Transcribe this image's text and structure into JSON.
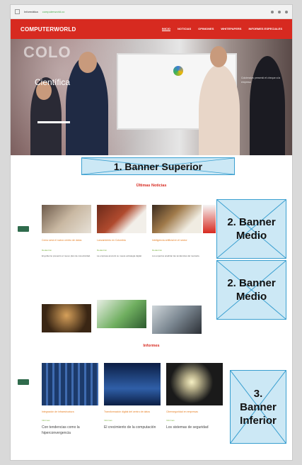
{
  "browser": {
    "title": "Informática",
    "url": "computerworld.co"
  },
  "header": {
    "logo": "COMPUTERWORLD",
    "nav": [
      "INICIO",
      "NOTICIAS",
      "OPINIONES",
      "WHITEPAPERS",
      "INFORMES ESPECIALES"
    ]
  },
  "hero": {
    "big_text": "COLO",
    "label": "Científica",
    "side_text": "Colciencias presentó el cheque a la empresa"
  },
  "banners": {
    "top": "1. Banner Superior",
    "mid1_line1": "2. Banner",
    "mid1_line2": "Medio",
    "mid2_line1": "2. Banner",
    "mid2_line2": "Medio",
    "bot_line1": "3.",
    "bot_line2": "Banner",
    "bot_line3": "Inferior"
  },
  "sections": {
    "latest": "Últimas Noticias",
    "reports": "Informes"
  },
  "news": [
    {
      "title": "Cómo será el nuevo centro de datos",
      "meta": "Redacción",
      "text": "El gobierno presentó el nuevo plan de conectividad."
    },
    {
      "title": "Lanzamiento en Colombia",
      "meta": "Redacción",
      "text": "La empresa anunció su nueva estrategia digital."
    },
    {
      "title": "Inteligencia artificial en el sector",
      "meta": "Redacción",
      "text": "Los expertos analizan las tendencias del mercado."
    }
  ],
  "reports": [
    {
      "title": "Integración de infraestructura",
      "meta": "Informes",
      "text": "Con tendencias como la hiperconvergencia"
    },
    {
      "title": "Transformación digital del centro de datos",
      "meta": "Informes",
      "text": "El crecimiento de la computación"
    },
    {
      "title": "Ciberseguridad en empresas",
      "meta": "Informes",
      "text": "Los sistemas de seguridad"
    }
  ],
  "colors": {
    "brand": "#d72a20",
    "banner_fill": "#cce8f5",
    "banner_border": "#3a9fd0"
  }
}
